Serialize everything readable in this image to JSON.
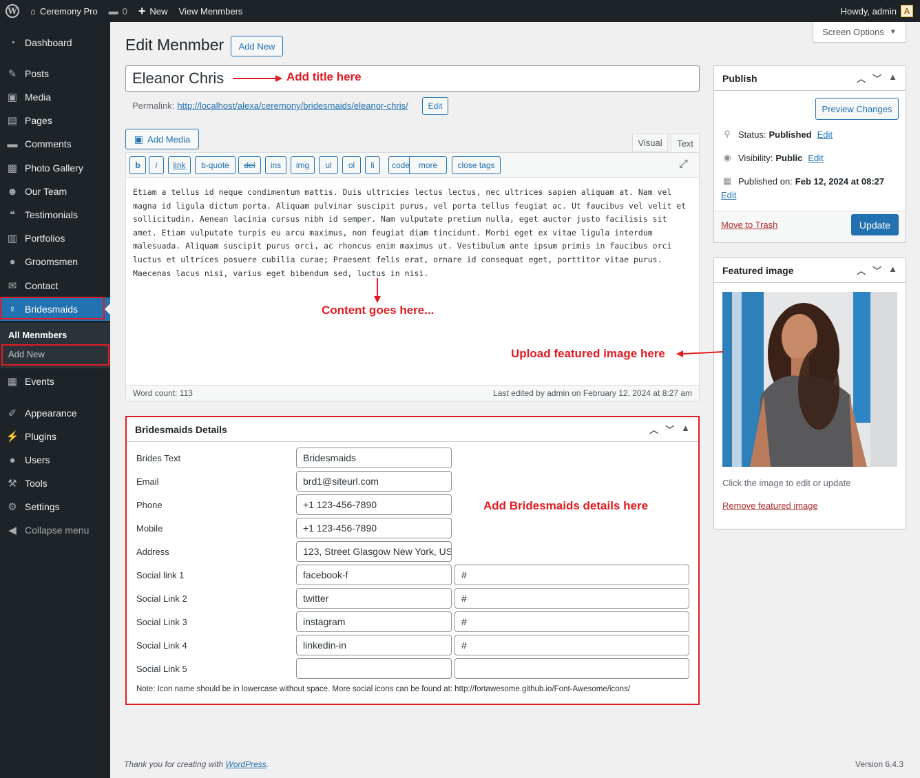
{
  "adminbar": {
    "site_name": "Ceremony Pro",
    "comments_count": "0",
    "new_label": "New",
    "view_label": "View Menmbers",
    "howdy": "Howdy, admin"
  },
  "sidebar": {
    "items": [
      {
        "label": "Dashboard",
        "icon": "dashboard-icon"
      },
      {
        "label": "Posts",
        "icon": "pin-icon"
      },
      {
        "label": "Media",
        "icon": "media-icon"
      },
      {
        "label": "Pages",
        "icon": "page-icon"
      },
      {
        "label": "Comments",
        "icon": "comment-icon"
      },
      {
        "label": "Photo Gallery",
        "icon": "gallery-icon"
      },
      {
        "label": "Our Team",
        "icon": "group-icon"
      },
      {
        "label": "Testimonials",
        "icon": "quote-icon"
      },
      {
        "label": "Portfolios",
        "icon": "portfolio-icon"
      },
      {
        "label": "Groomsmen",
        "icon": "user-icon"
      },
      {
        "label": "Contact",
        "icon": "mail-icon"
      },
      {
        "label": "Bridesmaids",
        "icon": "bridesmaid-icon"
      },
      {
        "label": "Events",
        "icon": "calendar-icon"
      },
      {
        "label": "Appearance",
        "icon": "brush-icon"
      },
      {
        "label": "Plugins",
        "icon": "plugin-icon"
      },
      {
        "label": "Users",
        "icon": "user-icon"
      },
      {
        "label": "Tools",
        "icon": "wrench-icon"
      },
      {
        "label": "Settings",
        "icon": "settings-icon"
      },
      {
        "label": "Collapse menu",
        "icon": "collapse-icon"
      }
    ],
    "submenu": {
      "all": "All Menmbers",
      "add_new": "Add New"
    }
  },
  "screen_options": "Screen Options",
  "page": {
    "title": "Edit Menmber",
    "add_new": "Add New",
    "post_title": "Eleanor Chris",
    "permalink_label": "Permalink:",
    "permalink_url": "http://localhost/alexa/ceremony/bridesmaids/eleanor-chris/",
    "permalink_edit": "Edit"
  },
  "editor": {
    "add_media": "Add Media",
    "tab_visual": "Visual",
    "tab_text": "Text",
    "quicktags": [
      "b",
      "i",
      "link",
      "b-quote",
      "del",
      "ins",
      "img",
      "ul",
      "ol",
      "li",
      "code",
      "more",
      "close tags"
    ],
    "content": "Etiam a tellus id neque condimentum mattis. Duis ultricies lectus lectus, nec ultrices sapien aliquam at. Nam vel magna id ligula dictum porta. Aliquam pulvinar suscipit purus, vel porta tellus feugiat ac. Ut faucibus vel velit et sollicitudin. Aenean lacinia cursus nibh id semper. Nam vulputate pretium nulla, eget auctor justo facilisis sit amet. Etiam vulputate turpis eu arcu maximus, non feugiat diam tincidunt. Morbi eget ex vitae ligula interdum malesuada. Aliquam suscipit purus orci, ac rhoncus enim maximus ut. Vestibulum ante ipsum primis in faucibus orci luctus et ultrices posuere cubilia curae; Praesent felis erat, ornare id consequat eget, porttitor vitae purus. Maecenas lacus nisi, varius eget bibendum sed, luctus in nisi.",
    "word_count": "Word count: 113",
    "last_edited": "Last edited by admin on February 12, 2024 at 8:27 am"
  },
  "annotations": {
    "title": "Add title here",
    "content": "Content goes here...",
    "featured": "Upload featured image here",
    "details": "Add Bridesmaids details here"
  },
  "details": {
    "title": "Bridesmaids Details",
    "fields": [
      {
        "label": "Brides Text",
        "value": "Bridesmaids"
      },
      {
        "label": "Email",
        "value": "brd1@siteurl.com"
      },
      {
        "label": "Phone",
        "value": "+1 123-456-7890"
      },
      {
        "label": "Mobile",
        "value": "+1 123-456-7890"
      },
      {
        "label": "Address",
        "value": "123, Street Glasgow New York, US"
      }
    ],
    "social": [
      {
        "label": "Social link 1",
        "icon": "facebook-f",
        "url": "#"
      },
      {
        "label": "Social Link 2",
        "icon": "twitter",
        "url": "#"
      },
      {
        "label": "Social Link 3",
        "icon": "instagram",
        "url": "#"
      },
      {
        "label": "Social Link 4",
        "icon": "linkedin-in",
        "url": "#"
      },
      {
        "label": "Social Link 5",
        "icon": "",
        "url": ""
      }
    ],
    "note": "Note: Icon name should be in lowercase without space. More social icons can be found at: http://fortawesome.github.io/Font-Awesome/icons/"
  },
  "publish": {
    "title": "Publish",
    "preview": "Preview Changes",
    "status_label": "Status:",
    "status_value": "Published",
    "visibility_label": "Visibility:",
    "visibility_value": "Public",
    "published_label": "Published on:",
    "published_value": "Feb 12, 2024 at 08:27",
    "edit": "Edit",
    "trash": "Move to Trash",
    "update": "Update"
  },
  "featured": {
    "title": "Featured image",
    "hint": "Click the image to edit or update",
    "remove": "Remove featured image"
  },
  "footer": {
    "thanks": "Thank you for creating with",
    "wp_link": "WordPress",
    "version": "Version 6.4.3"
  },
  "colors": {
    "accent": "#2271b1",
    "annotation": "#e11b22",
    "sidebar": "#1d2327"
  }
}
